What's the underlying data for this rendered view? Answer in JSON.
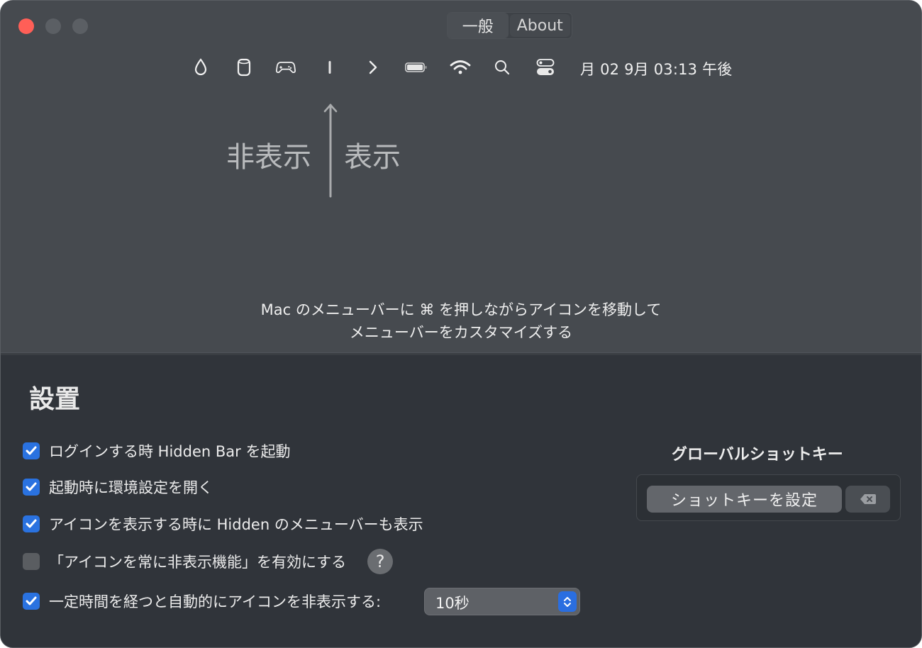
{
  "window": {
    "traffic_lights": [
      "close",
      "minimize",
      "zoom"
    ]
  },
  "tabs": [
    {
      "label": "一般",
      "selected": true
    },
    {
      "label": "About",
      "selected": false
    }
  ],
  "menubar_preview": {
    "icons": [
      "drop-icon",
      "homepod-icon",
      "gamepad-icon",
      "separator-bar-icon",
      "chevron-right-icon",
      "battery-icon",
      "wifi-icon",
      "search-icon",
      "control-center-icon"
    ],
    "clock": "月 02 9月 03:13 午後"
  },
  "diagram": {
    "hidden_label": "非表示",
    "shown_label": "表示"
  },
  "hint": {
    "line1": "Mac のメニューバーに  ⌘ を押しながらアイコンを移動して",
    "line2": "メニューバーをカスタマイズする"
  },
  "settings": {
    "title": "設置",
    "options": [
      {
        "label": "ログインする時 Hidden Bar を起動",
        "checked": true
      },
      {
        "label": "起動時に環境設定を開く",
        "checked": true
      },
      {
        "label": "アイコンを表示する時に Hidden のメニューバーも表示",
        "checked": true
      },
      {
        "label": "「アイコンを常に非表示機能」を有効にする",
        "checked": false
      },
      {
        "label": "一定時間を経つと自動的にアイコンを非表示する:",
        "checked": true
      }
    ],
    "help_label": "?",
    "auto_hide_delay": {
      "value": "10秒"
    }
  },
  "hotkey": {
    "title": "グローバルショットキー",
    "set_button": "ショットキーを設定",
    "clear_icon": "delete-backward-icon"
  },
  "colors": {
    "accent": "#2a72e0",
    "close": "#ff5f57",
    "top_panel": "#464a4f",
    "bottom_panel": "#30343a"
  }
}
